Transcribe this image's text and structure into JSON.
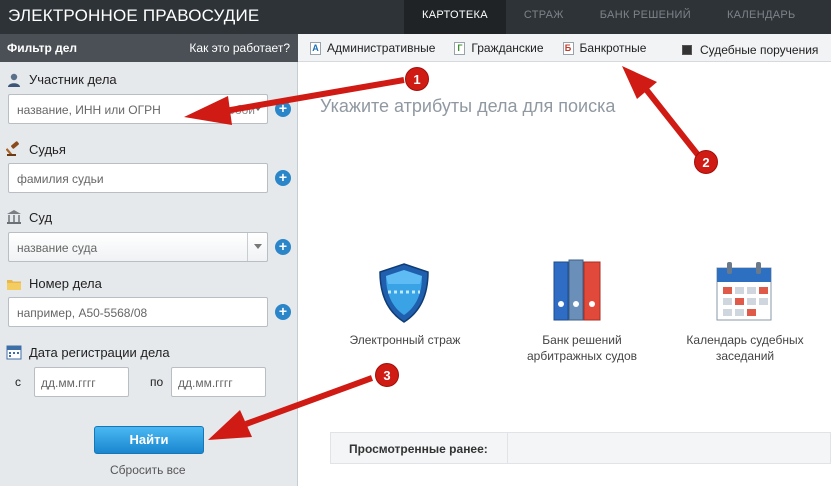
{
  "header": {
    "brand": "ЭЛЕКТРОННОЕ ПРАВОСУДИЕ",
    "tabs": [
      {
        "label": "КАРТОТЕКА",
        "active": true
      },
      {
        "label": "СТРАЖ",
        "active": false
      },
      {
        "label": "БАНК РЕШЕНИЙ",
        "active": false
      },
      {
        "label": "КАЛЕНДАРЬ",
        "active": false
      }
    ]
  },
  "filter": {
    "title": "Фильтр дел",
    "how_link": "Как это работает?"
  },
  "categories": [
    {
      "icon_letter": "А",
      "label": "Административные",
      "color": "#1d6fb8"
    },
    {
      "icon_letter": "Г",
      "label": "Гражданские",
      "color": "#3c8f2f"
    },
    {
      "icon_letter": "Б",
      "label": "Банкротные",
      "color": "#c0392b"
    }
  ],
  "court_orders": {
    "label": "Судебные поручения"
  },
  "sidebar": {
    "participant": {
      "label": "Участник дела",
      "placeholder": "название, ИНН или ОГРН",
      "role": "любой"
    },
    "judge": {
      "label": "Судья",
      "placeholder": "фамилия судьи"
    },
    "court": {
      "label": "Суд",
      "placeholder": "название суда"
    },
    "case_number": {
      "label": "Номер дела",
      "placeholder": "например, А50-5568/08"
    },
    "reg_date": {
      "label": "Дата регистрации дела",
      "from_label": "с",
      "to_label": "по",
      "from_placeholder": "дд.мм.гггг",
      "to_placeholder": "дд.мм.гггг"
    },
    "find_button": "Найти",
    "reset_link": "Сбросить все"
  },
  "main": {
    "prompt": "Укажите атрибуты дела для поиска",
    "features": [
      {
        "icon": "shield-icon",
        "label": "Электронный страж"
      },
      {
        "icon": "binders-icon",
        "label": "Банк решений арбитражных судов"
      },
      {
        "icon": "calendar-icon",
        "label": "Календарь судебных заседаний"
      }
    ],
    "recent_label": "Просмотренные ранее:"
  },
  "annotations": {
    "badges": [
      "1",
      "2",
      "3"
    ],
    "color": "#d01a14"
  }
}
